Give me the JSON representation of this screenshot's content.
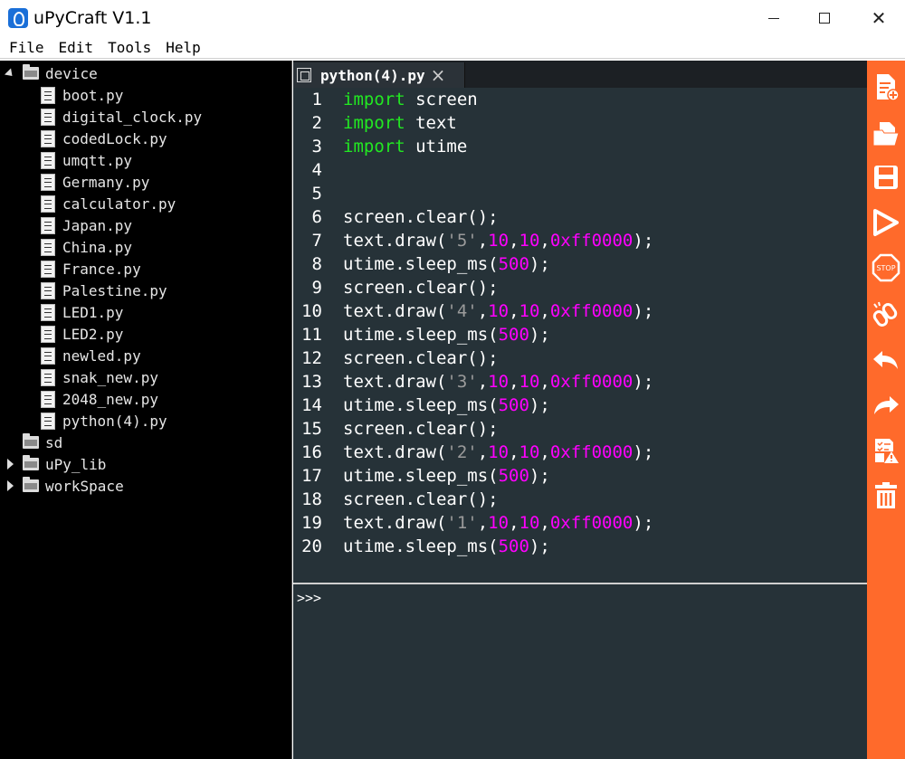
{
  "window": {
    "title": "uPyCraft V1.1",
    "minimize_icon": "minimize-icon",
    "maximize_icon": "maximize-icon",
    "close_glyph": "✕"
  },
  "menu": [
    "File",
    "Edit",
    "Tools",
    "Help"
  ],
  "tree": {
    "device": {
      "label": "device",
      "files": [
        "boot.py",
        "digital_clock.py",
        "codedLock.py",
        "umqtt.py",
        "Germany.py",
        "calculator.py",
        "Japan.py",
        "China.py",
        "France.py",
        "Palestine.py",
        "LED1.py",
        "LED2.py",
        "newled.py",
        "snak_new.py",
        "2048_new.py",
        "python(4).py"
      ]
    },
    "sd": {
      "label": "sd"
    },
    "uPy_lib": {
      "label": "uPy_lib"
    },
    "workSpace": {
      "label": "workSpace"
    }
  },
  "editor": {
    "tab_label": "python(4).py",
    "tab_close": "×",
    "lines": [
      {
        "n": "1",
        "code": "import screen"
      },
      {
        "n": "2",
        "code": "import text"
      },
      {
        "n": "3",
        "code": "import utime"
      },
      {
        "n": "4",
        "code": ""
      },
      {
        "n": "5",
        "code": ""
      },
      {
        "n": "6",
        "code": "screen.clear();"
      },
      {
        "n": "7",
        "code": "text.draw('5',10,10,0xff0000);"
      },
      {
        "n": "8",
        "code": "utime.sleep_ms(500);"
      },
      {
        "n": "9",
        "code": "screen.clear();"
      },
      {
        "n": "10",
        "code": "text.draw('4',10,10,0xff0000);"
      },
      {
        "n": "11",
        "code": "utime.sleep_ms(500);"
      },
      {
        "n": "12",
        "code": "screen.clear();"
      },
      {
        "n": "13",
        "code": "text.draw('3',10,10,0xff0000);"
      },
      {
        "n": "14",
        "code": "utime.sleep_ms(500);"
      },
      {
        "n": "15",
        "code": "screen.clear();"
      },
      {
        "n": "16",
        "code": "text.draw('2',10,10,0xff0000);"
      },
      {
        "n": "17",
        "code": "utime.sleep_ms(500);"
      },
      {
        "n": "18",
        "code": "screen.clear();"
      },
      {
        "n": "19",
        "code": "text.draw('1',10,10,0xff0000);"
      },
      {
        "n": "20",
        "code": "utime.sleep_ms(500);"
      }
    ]
  },
  "console": {
    "prompt": ">>>"
  },
  "toolbar": {
    "accent": "#ff6a2b",
    "buttons": [
      "new-file-icon",
      "open-folder-icon",
      "save-icon",
      "run-icon",
      "stop-icon",
      "connect-icon",
      "undo-icon",
      "redo-icon",
      "syntax-check-icon",
      "clear-icon"
    ],
    "stop_text": "STOP"
  },
  "colors": {
    "editor_bg": "#263238",
    "keyword": "#22e822",
    "number": "#ff00ff",
    "string": "#9b9b9b"
  }
}
